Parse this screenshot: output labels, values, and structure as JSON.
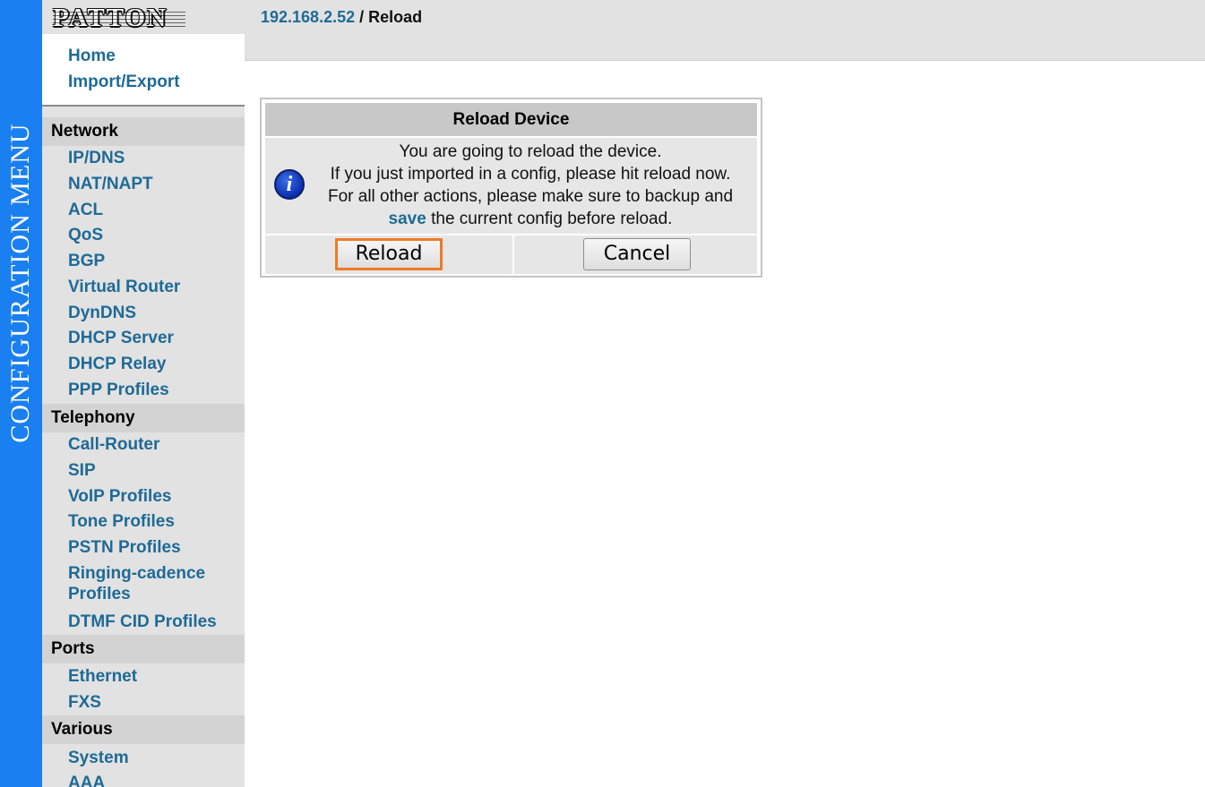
{
  "banner": {
    "text": "CONFIGURATION MENU",
    "color": "#1a7ff0"
  },
  "logo": {
    "text": "PATTON"
  },
  "sidebar": {
    "top_links": [
      "Home",
      "Import/Export"
    ],
    "sections": [
      {
        "title": "Network",
        "items": [
          "IP/DNS",
          "NAT/NAPT",
          "ACL",
          "QoS",
          "BGP",
          "Virtual Router",
          "DynDNS",
          "DHCP Server",
          "DHCP Relay",
          "PPP Profiles"
        ]
      },
      {
        "title": "Telephony",
        "items": [
          "Call-Router",
          "SIP",
          "VoIP Profiles",
          "Tone Profiles",
          "PSTN Profiles",
          "Ringing-cadence Profiles",
          "DTMF CID Profiles"
        ]
      },
      {
        "title": "Ports",
        "items": [
          "Ethernet",
          "FXS"
        ]
      },
      {
        "title": "Various",
        "items": [
          "System",
          "AAA"
        ]
      }
    ]
  },
  "header": {
    "ip": "192.168.2.52",
    "separator": "/",
    "page": "Reload"
  },
  "dialog": {
    "title": "Reload Device",
    "line1": "You are going to reload the device.",
    "line2": "If you just imported in a config, please hit reload now.",
    "line3": "For all other actions, please make sure to backup and",
    "line4_link": "save",
    "line4_rest": " the current config before reload.",
    "reload_label": "Reload",
    "cancel_label": "Cancel",
    "icon": "info-icon"
  },
  "colors": {
    "link": "#1f6a96",
    "highlight": "#f07a26",
    "sidebar_bg": "#e2e2e2"
  }
}
